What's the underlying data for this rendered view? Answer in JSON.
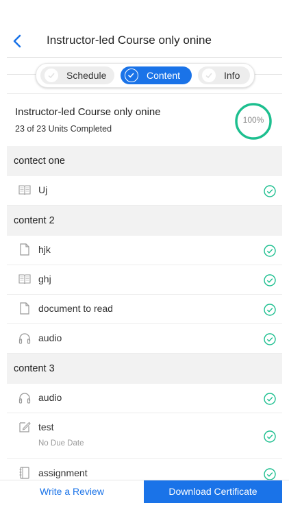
{
  "header": {
    "title": "Instructor-led Course only onine"
  },
  "tabs": [
    {
      "label": "Schedule",
      "active": false
    },
    {
      "label": "Content",
      "active": true
    },
    {
      "label": "Info",
      "active": false
    }
  ],
  "summary": {
    "title": "Instructor-led Course only onine",
    "progress_text": "23 of 23 Units Completed",
    "percent_label": "100%",
    "percent": 100
  },
  "sections": [
    {
      "title": "contect one",
      "items": [
        {
          "name": "Uj",
          "icon": "book-icon",
          "status": "completed"
        }
      ]
    },
    {
      "title": "content 2",
      "items": [
        {
          "name": "hjk",
          "icon": "document-icon",
          "status": "completed"
        },
        {
          "name": "ghj",
          "icon": "book-icon",
          "status": "completed"
        },
        {
          "name": "document to read",
          "icon": "document-icon",
          "status": "completed"
        },
        {
          "name": "audio",
          "icon": "headphones-icon",
          "status": "completed"
        }
      ]
    },
    {
      "title": "content 3",
      "items": [
        {
          "name": "audio",
          "icon": "headphones-icon",
          "status": "completed"
        },
        {
          "name": "test",
          "sub": "No Due Date",
          "icon": "edit-icon",
          "status": "completed"
        },
        {
          "name": "assignment",
          "icon": "notebook-icon",
          "status": "completed"
        }
      ]
    }
  ],
  "footer": {
    "review_label": "Write a Review",
    "certificate_label": "Download Certificate"
  },
  "colors": {
    "accent": "#1a73e8",
    "success": "#1dbf8f",
    "section_bg": "#f2f2f2"
  }
}
